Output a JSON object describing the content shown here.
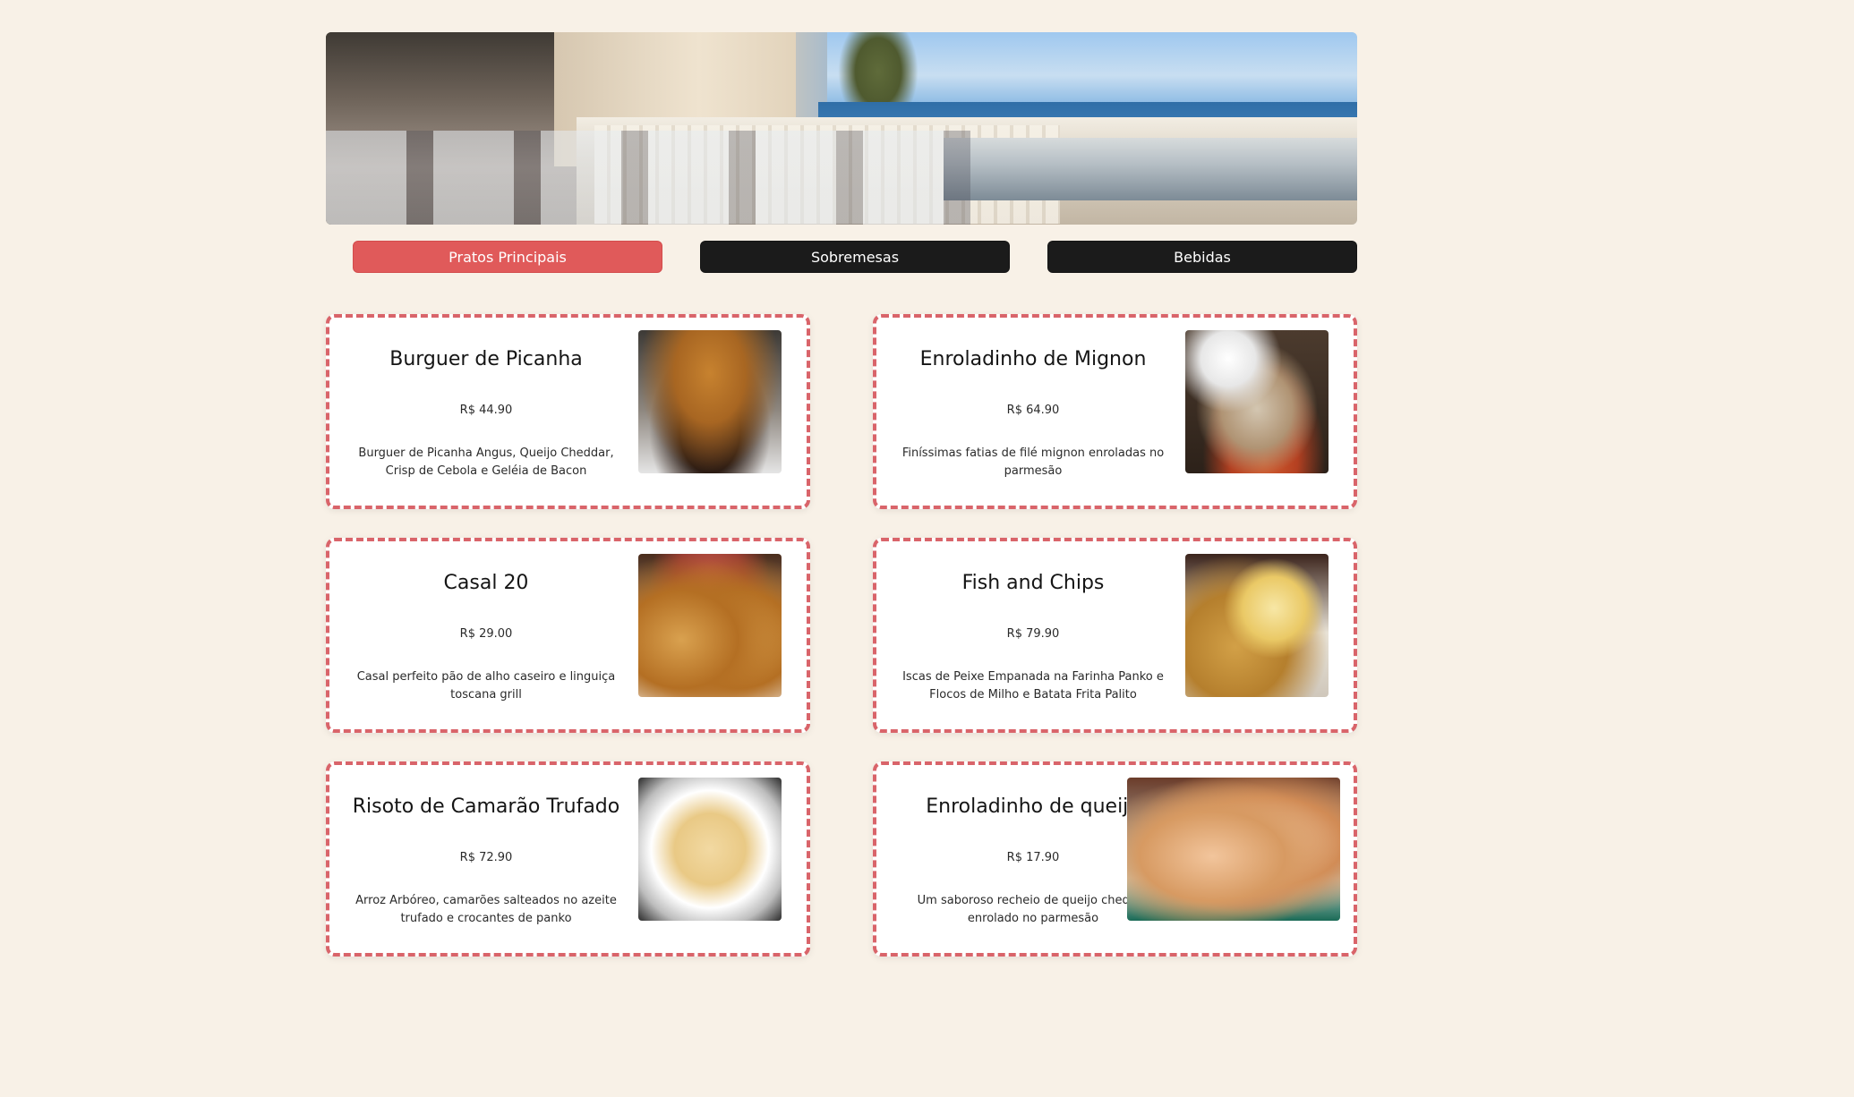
{
  "tabs": [
    {
      "label": "Pratos Principais",
      "active": true
    },
    {
      "label": "Sobremesas",
      "active": false
    },
    {
      "label": "Bebidas",
      "active": false
    }
  ],
  "colors": {
    "background": "#f8f1e7",
    "active_tab": "#e05a5a",
    "tab_dark": "#1b1b1b",
    "card_border": "#d9646a"
  },
  "menu": {
    "items": [
      {
        "title": "Burguer de Picanha",
        "price": "R$ 44.90",
        "description": "Burguer de Picanha Angus, Queijo Cheddar, Crisp de Cebola e Geléia de Bacon",
        "image_icon": "burger-photo"
      },
      {
        "title": "Enroladinho de Mignon",
        "price": "R$ 64.90",
        "description": "Finíssimas fatias de filé mignon enroladas no parmesão",
        "image_icon": "enroladinho-mignon-photo"
      },
      {
        "title": "Casal 20",
        "price": "R$ 29.00",
        "description": "Casal perfeito pão de alho caseiro e linguiça toscana grill",
        "image_icon": "casal-20-photo"
      },
      {
        "title": "Fish and Chips",
        "price": "R$ 79.90",
        "description": "Iscas de Peixe Empanada na Farinha Panko e Flocos de Milho e Batata Frita Palito",
        "image_icon": "fish-and-chips-photo"
      },
      {
        "title": "Risoto de Camarão Trufado",
        "price": "R$ 72.90",
        "description": "Arroz Arbóreo, camarões salteados no azeite trufado e crocantes de panko",
        "image_icon": "risoto-photo"
      },
      {
        "title": "Enroladinho de queijo",
        "price": "R$ 17.90",
        "description": "Um saboroso recheio de queijo cheddar enrolado no parmesão",
        "image_icon": "enroladinho-queijo-photo"
      }
    ]
  }
}
